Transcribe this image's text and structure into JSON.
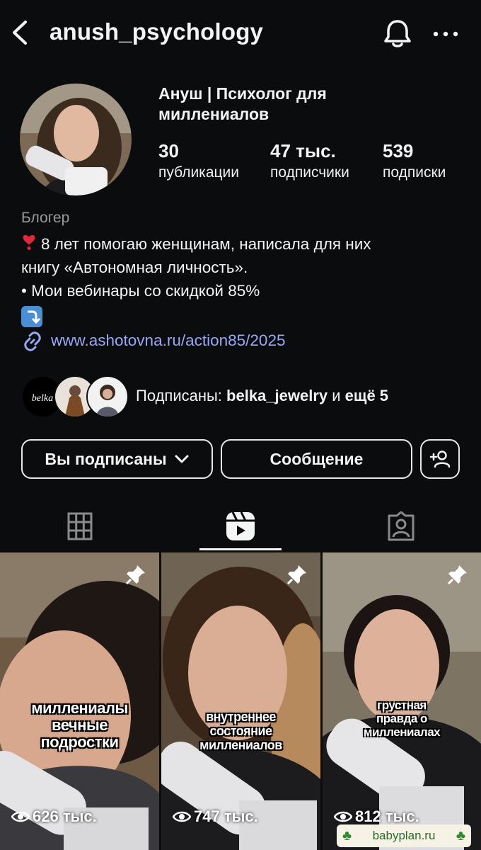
{
  "header": {
    "username": "anush_psychology",
    "icons": [
      "chevron-left-icon",
      "bell-icon",
      "more-icon"
    ]
  },
  "profile": {
    "full_name": "Ануш | Психолог для миллениалов",
    "stats": [
      {
        "value": "30",
        "label": "публикации"
      },
      {
        "value": "47 тыс.",
        "label": "подписчики"
      },
      {
        "value": "539",
        "label": "подписки"
      }
    ],
    "category": "Блогер",
    "bio": {
      "line1": "8 лет помогаю женщинам, написала для них",
      "line2": "книгу «Автономная личность».",
      "line3": "• Мои вебинары со скидкой 85%"
    },
    "link": "www.ashotovna.ru/action85/2025"
  },
  "followed_by": {
    "prefix": "Подписаны: ",
    "account": "belka_jewelry",
    "middle": " и ",
    "rest": "ещё 5",
    "first_avatar_text": "belka"
  },
  "actions": {
    "following_label": "Вы подписаны",
    "message_label": "Сообщение"
  },
  "tabs": [
    "grid-icon",
    "reels-icon",
    "tagged-icon"
  ],
  "reels": [
    {
      "caption": "миллениалы вечные подростки",
      "views": "626 тыс."
    },
    {
      "caption": "внутреннее состояние миллениалов",
      "views": "747 тыс."
    },
    {
      "caption": "грустная правда о миллениалах",
      "views": "812 тыс."
    }
  ],
  "watermark": "babyplan.ru",
  "colors": {
    "background": "#0b0c0e",
    "link": "#9aa7f5",
    "secondary_text": "#9a9a9a",
    "bio_heart": "#e0283a"
  }
}
